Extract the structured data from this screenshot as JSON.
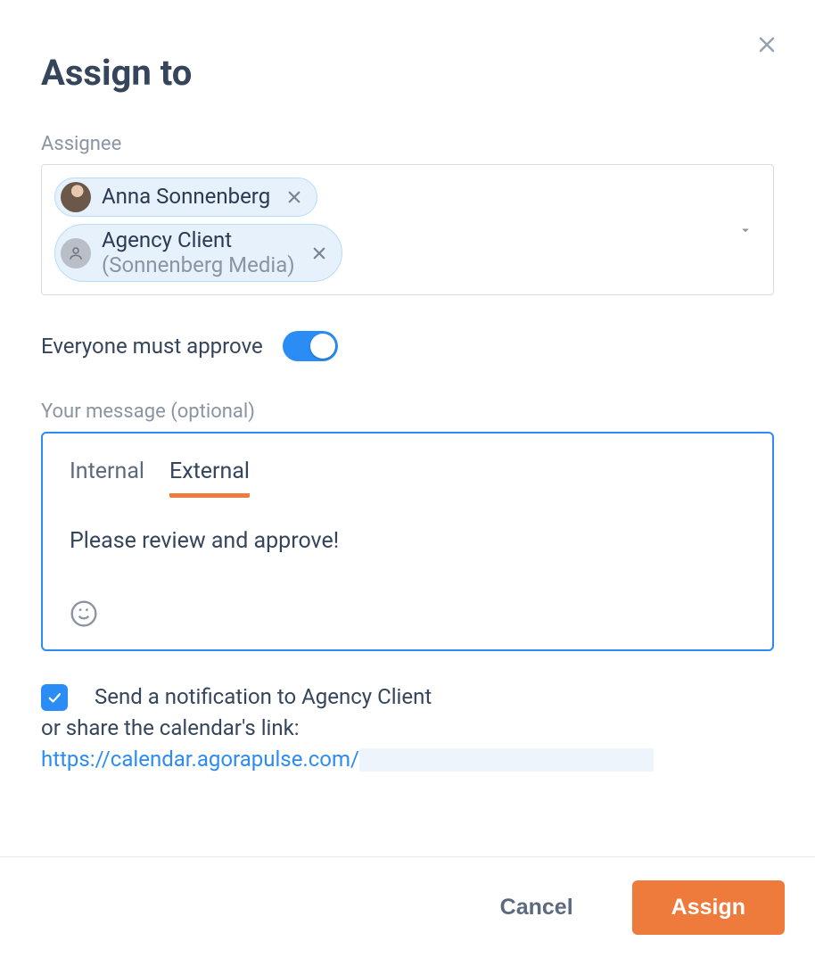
{
  "modal": {
    "title": "Assign to",
    "assignee_label": "Assignee",
    "assignees": [
      {
        "name": "Anna Sonnenberg",
        "sub": ""
      },
      {
        "name": "Agency Client",
        "sub": "(Sonnenberg Media)"
      }
    ],
    "everyone_must_approve_label": "Everyone must approve",
    "everyone_must_approve": true,
    "message_label": "Your message (optional)",
    "tabs": {
      "internal": "Internal",
      "external": "External",
      "active": "external"
    },
    "message_text": "Please review and approve!",
    "notify": {
      "checked": true,
      "line1": "Send a notification to Agency Client",
      "line2_prefix": "or share the calendar's link:",
      "link_text": "https://calendar.agorapulse.com/"
    },
    "footer": {
      "cancel": "Cancel",
      "assign": "Assign"
    }
  },
  "colors": {
    "accent_blue": "#2a8cf4",
    "accent_orange": "#ee7b3c"
  }
}
